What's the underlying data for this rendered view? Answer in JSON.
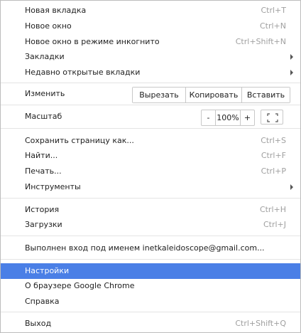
{
  "menu": {
    "new_tab": {
      "label": "Новая вкладка",
      "shortcut": "Ctrl+T"
    },
    "new_window": {
      "label": "Новое окно",
      "shortcut": "Ctrl+N"
    },
    "new_incognito": {
      "label": "Новое окно в режиме инкогнито",
      "shortcut": "Ctrl+Shift+N"
    },
    "bookmarks": {
      "label": "Закладки"
    },
    "recent_tabs": {
      "label": "Недавно открытые вкладки"
    },
    "edit": {
      "label": "Изменить",
      "cut": "Вырезать",
      "copy": "Копировать",
      "paste": "Вставить"
    },
    "zoom": {
      "label": "Масштаб",
      "minus": "-",
      "value": "100%",
      "plus": "+"
    },
    "save_page": {
      "label": "Сохранить страницу как...",
      "shortcut": "Ctrl+S"
    },
    "find": {
      "label": "Найти...",
      "shortcut": "Ctrl+F"
    },
    "print": {
      "label": "Печать...",
      "shortcut": "Ctrl+P"
    },
    "tools": {
      "label": "Инструменты"
    },
    "history": {
      "label": "История",
      "shortcut": "Ctrl+H"
    },
    "downloads": {
      "label": "Загрузки",
      "shortcut": "Ctrl+J"
    },
    "signed_in": {
      "label": "Выполнен вход под именем inetkaleidoscope@gmail.com..."
    },
    "settings": {
      "label": "Настройки"
    },
    "about": {
      "label": "О браузере Google Chrome"
    },
    "help": {
      "label": "Справка"
    },
    "exit": {
      "label": "Выход",
      "shortcut": "Ctrl+Shift+Q"
    }
  },
  "colors": {
    "highlight": "#4a7fe6",
    "shortcut": "#a0a0a0",
    "separator": "#e4e4e4"
  }
}
